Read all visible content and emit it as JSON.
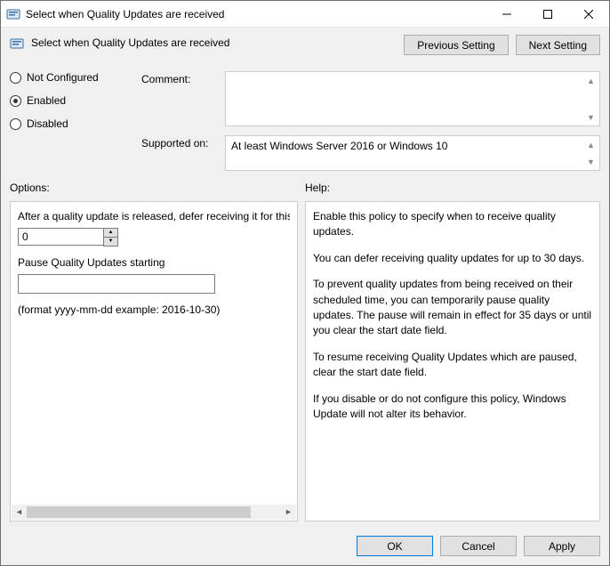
{
  "window": {
    "title": "Select when Quality Updates are received"
  },
  "header": {
    "subtitle": "Select when Quality Updates are received",
    "prev_label": "Previous Setting",
    "next_label": "Next Setting"
  },
  "config": {
    "not_configured_label": "Not Configured",
    "enabled_label": "Enabled",
    "disabled_label": "Disabled",
    "selected": "enabled",
    "comment_label": "Comment:",
    "comment_value": "",
    "supported_label": "Supported on:",
    "supported_value": "At least Windows Server 2016 or Windows 10"
  },
  "panels": {
    "options_label": "Options:",
    "help_label": "Help:"
  },
  "options": {
    "defer_label": "After a quality update is released, defer receiving it for this many days:",
    "defer_value": "0",
    "pause_label": "Pause Quality Updates starting",
    "pause_value": "",
    "format_hint": "(format yyyy-mm-dd example: 2016-10-30)"
  },
  "help": {
    "p1": "Enable this policy to specify when to receive quality updates.",
    "p2": "You can defer receiving quality updates for up to 30 days.",
    "p3": "To prevent quality updates from being received on their scheduled time, you can temporarily pause quality updates. The pause will remain in effect for 35 days or until you clear the start date field.",
    "p4": "To resume receiving Quality Updates which are paused, clear the start date field.",
    "p5": "If you disable or do not configure this policy, Windows Update will not alter its behavior."
  },
  "footer": {
    "ok_label": "OK",
    "cancel_label": "Cancel",
    "apply_label": "Apply"
  }
}
